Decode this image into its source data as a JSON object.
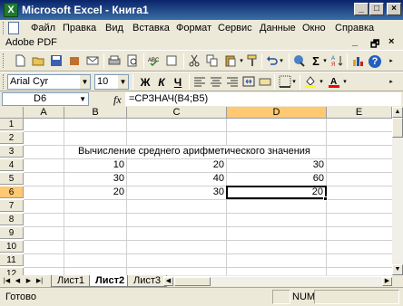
{
  "window": {
    "app_icon_letter": "X",
    "title": "Microsoft Excel - Книга1",
    "min_glyph": "_",
    "max_glyph": "□",
    "close_glyph": "×"
  },
  "menu": {
    "items": [
      "Файл",
      "Правка",
      "Вид",
      "Вставка",
      "Формат",
      "Сервис",
      "Данные",
      "Окно",
      "Справка"
    ],
    "mdi_min": "_",
    "mdi_restore": "🗗",
    "mdi_close": "×"
  },
  "adobe_bar": {
    "label": "Adobe PDF"
  },
  "toolbar_standard": {
    "sum_glyph": "Σ",
    "zoom_glyph": "?"
  },
  "toolbar_format": {
    "font_name": "Arial Cyr",
    "font_size": "10",
    "bold": "Ж",
    "italic": "К",
    "underline": "Ч"
  },
  "formula_bar": {
    "name_box": "D6",
    "fx_label": "fx",
    "formula": "=СРЗНАЧ(B4;B5)"
  },
  "grid": {
    "columns": [
      "A",
      "B",
      "C",
      "D",
      "E"
    ],
    "rows": [
      "1",
      "2",
      "3",
      "4",
      "5",
      "6",
      "7",
      "8",
      "9",
      "10",
      "11",
      "12"
    ],
    "active_cell": "D6",
    "cells": {
      "B3": "Вычисление среднего арифметического значения",
      "B4": "10",
      "C4": "20",
      "D4": "30",
      "B5": "30",
      "C5": "40",
      "D5": "60",
      "B6": "20",
      "C6": "30",
      "D6": "20"
    }
  },
  "sheets": {
    "tabs": [
      "Лист1",
      "Лист2",
      "Лист3"
    ],
    "active": "Лист2"
  },
  "status": {
    "ready": "Готово",
    "num_lock": "NUM"
  }
}
